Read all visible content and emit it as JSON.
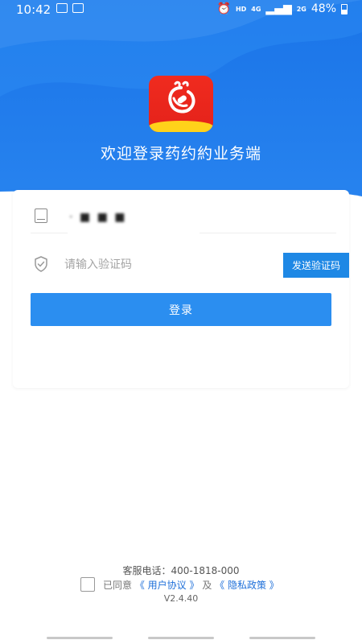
{
  "status_bar": {
    "time": "10:42",
    "network_hd": "HD",
    "network_4g": "4G",
    "network_2g": "2G",
    "battery": "48%",
    "icons": [
      "image-icon",
      "check-square-icon",
      "alarm-icon",
      "signal-icon",
      "battery-icon"
    ]
  },
  "header": {
    "logo": "app-logo",
    "welcome": "欢迎登录药约約业务端"
  },
  "form": {
    "phone_value": "· ■ ■ ■",
    "phone_icon": "phone-icon",
    "code_icon": "shield-check-icon",
    "code_placeholder": "请输入验证码",
    "code_value": "",
    "send_code_label": "发送验证码",
    "login_label": "登录"
  },
  "footer": {
    "service_phone": "客服电话：400-1818-000",
    "agree_prefix": "已同意",
    "user_agreement": "《 用户协议 》",
    "and": "及",
    "privacy_policy": "《 隐私政策 》",
    "version": "V2.4.40"
  },
  "colors": {
    "primary": "#2b8ef0",
    "header_blue": "#1a74e8",
    "logo_red": "#e4221a",
    "logo_yellow": "#ffd21a",
    "link": "#1e6fd9"
  }
}
